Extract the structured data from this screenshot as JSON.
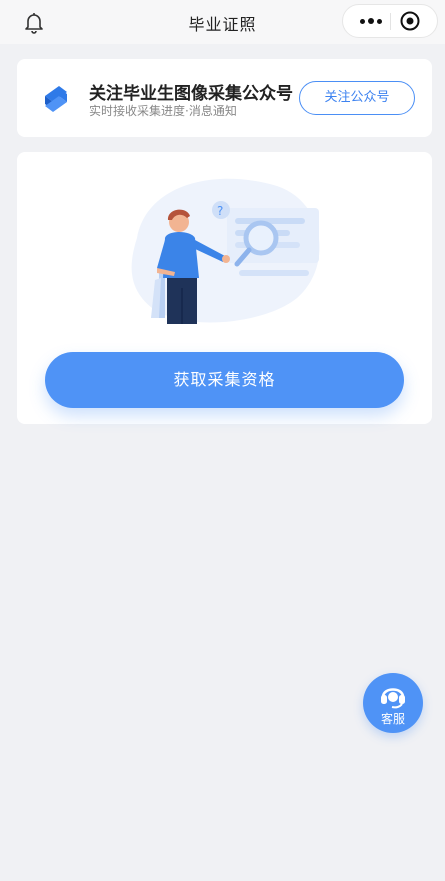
{
  "topbar": {
    "title": "毕业证照",
    "icons": [
      "bell-icon",
      "more-icon",
      "close-mini-program-icon"
    ]
  },
  "follow_card": {
    "title": "关注毕业生图像采集公众号",
    "subtitle": "实时接收采集进度·消息通知",
    "button_label": "关注公众号"
  },
  "main_card": {
    "button_label": "获取采集资格",
    "illustration_icons": [
      "question-mark-icon"
    ],
    "illustration_glyph": "?"
  },
  "service": {
    "label": "客服",
    "icon": "customer-service-headset-icon"
  },
  "colors": {
    "accent": "#4f93f6",
    "background": "#f0f1f4",
    "card": "#ffffff"
  }
}
